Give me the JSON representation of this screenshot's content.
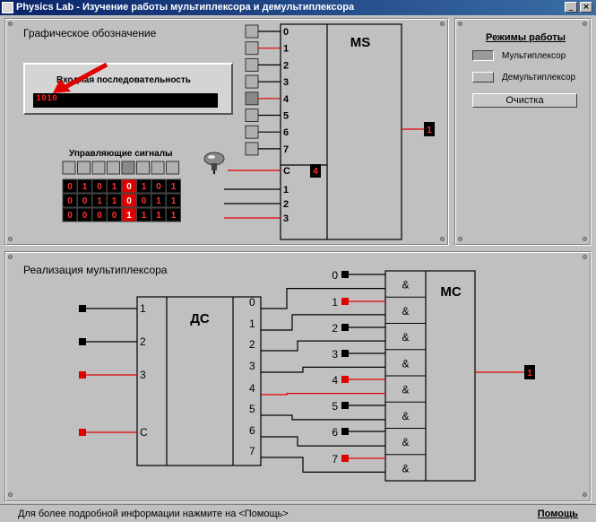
{
  "window": {
    "title": "Physics Lab - Изучение работы мультиплексора и демультиплексора",
    "minimize": "_",
    "close": "×"
  },
  "top_panel": {
    "title": "Графическое обозначение",
    "input_sequence": {
      "label": "Входная последовательность",
      "value": "1010"
    },
    "control_signals": {
      "label": "Управляющие сигналы",
      "buttons": 8,
      "rows": [
        [
          "0",
          "1",
          "0",
          "1",
          "0",
          "1",
          "0",
          "1"
        ],
        [
          "0",
          "0",
          "1",
          "1",
          "0",
          "0",
          "1",
          "1"
        ],
        [
          "0",
          "0",
          "0",
          "0",
          "1",
          "1",
          "1",
          "1"
        ]
      ],
      "highlighted_column": 4
    },
    "ms_block": {
      "label": "MS",
      "data_inputs": [
        "0",
        "1",
        "2",
        "3",
        "4",
        "5",
        "6",
        "7"
      ],
      "strobe": "C",
      "strobe_value": "4",
      "address_inputs": [
        "1",
        "2",
        "3"
      ],
      "output_value": "1"
    }
  },
  "modes_panel": {
    "title": "Режимы работы",
    "modes": [
      {
        "label": "Мультиплексор",
        "active": true
      },
      {
        "label": "Демультиплексор",
        "active": false
      }
    ],
    "clear_label": "Очистка"
  },
  "bottom_panel": {
    "title": "Реализация мультиплексора",
    "dc": {
      "label": "ДС",
      "inputs": [
        "1",
        "2",
        "3",
        "C"
      ],
      "outputs": [
        "0",
        "1",
        "2",
        "3",
        "4",
        "5",
        "6",
        "7"
      ]
    },
    "mc": {
      "label": "МС",
      "gate_symbol": "&",
      "data_inputs": [
        "0",
        "1",
        "2",
        "3",
        "4",
        "5",
        "6",
        "7"
      ],
      "output_value": "1"
    }
  },
  "status": {
    "text": "Для более подробной информации нажмите на <Помощь>",
    "help_label": "Помощь"
  }
}
